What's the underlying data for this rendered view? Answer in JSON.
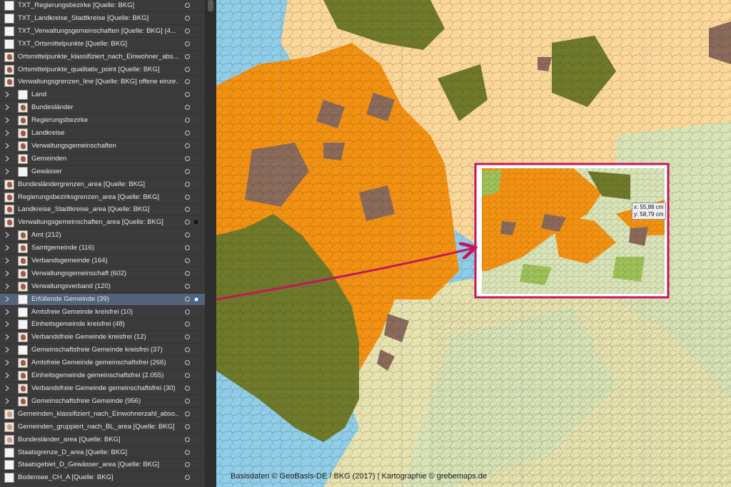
{
  "layers_panel": {
    "rows": [
      {
        "label": "TXT_Regierungsbezirke [Quelle: BKG]",
        "thumb": "blank",
        "indent": 0
      },
      {
        "label": "TXT_Landkreise_Stadtkreise [Quelle: BKG]",
        "thumb": "blank",
        "indent": 0
      },
      {
        "label": "TXT_Verwaltungsgemeinschaften [Quelle: BKG] (4...",
        "thumb": "blank",
        "indent": 0
      },
      {
        "label": "TXT_Ortsmittelpunkte [Quelle: BKG]",
        "thumb": "blank",
        "indent": 0
      },
      {
        "label": "Ortsmittelpunkte_klassifiziert_nach_Einwohner_abs...",
        "thumb": "map",
        "indent": 0
      },
      {
        "label": "Ortsmittelpunkte_qualitativ_point [Quelle: BKG]",
        "thumb": "map",
        "indent": 0
      },
      {
        "label": "Verwaltungsgrenzen_line [Quelle: BKG] offene einze...",
        "thumb": "map",
        "indent": 0
      },
      {
        "label": "Land",
        "thumb": "dots",
        "indent": 1
      },
      {
        "label": "Bundesländer",
        "thumb": "map",
        "indent": 1
      },
      {
        "label": "Regierungsbezirke",
        "thumb": "map",
        "indent": 1
      },
      {
        "label": "Landkreise",
        "thumb": "map",
        "indent": 1
      },
      {
        "label": "Verwaltungsgemeinschaften",
        "thumb": "map",
        "indent": 1
      },
      {
        "label": "Gemeinden",
        "thumb": "map",
        "indent": 1
      },
      {
        "label": "Gewässer",
        "thumb": "dots",
        "indent": 1
      },
      {
        "label": "Bundesländergrenzen_area [Quelle: BKG]",
        "thumb": "map",
        "indent": 0
      },
      {
        "label": "Regierungsbezirksgrenzen_area [Quelle: BKG]",
        "thumb": "map",
        "indent": 0
      },
      {
        "label": "Landkreise_Stadtkreise_area [Quelle: BKG]",
        "thumb": "map",
        "indent": 0
      },
      {
        "label": "Verwaltungsgemeinschaften_area [Quelle: BKG]",
        "thumb": "map",
        "indent": 0,
        "square": true
      },
      {
        "label": "Amt (212)",
        "thumb": "map",
        "indent": 1
      },
      {
        "label": "Samtgemeinde (116)",
        "thumb": "map",
        "indent": 1
      },
      {
        "label": "Verbandsgemeinde (164)",
        "thumb": "map",
        "indent": 1
      },
      {
        "label": "Verwaltungsgemeinschaft (602)",
        "thumb": "map",
        "indent": 1
      },
      {
        "label": "Verwaltungsverband (120)",
        "thumb": "map",
        "indent": 1
      },
      {
        "label": "Erfüllende Gemeinde (39)",
        "thumb": "dots",
        "indent": 1,
        "selected": true
      },
      {
        "label": "Amtsfreie Gemeinde kreisfrei (10)",
        "thumb": "dots",
        "indent": 1
      },
      {
        "label": "Einheitsgemeinde kreisfrei (48)",
        "thumb": "dots",
        "indent": 1
      },
      {
        "label": "Verbandsfreie Gemeinde kreisfrei (12)",
        "thumb": "map",
        "indent": 1
      },
      {
        "label": "Gemeinschaftsfreie Gemeinde kreisfrei (37)",
        "thumb": "dots",
        "indent": 1
      },
      {
        "label": "Amtsfreie Gemeinde gemeinschaftsfrei (266)",
        "thumb": "map",
        "indent": 1
      },
      {
        "label": "Einheitsgemeinde gemeinschaftsfrei (2.055)",
        "thumb": "map",
        "indent": 1
      },
      {
        "label": "Verbandsfreie Gemeinde gemeinschaftsfrei (30)",
        "thumb": "map",
        "indent": 1
      },
      {
        "label": "Gemeinschaftsfreie Gemeinde (956)",
        "thumb": "map",
        "indent": 1
      },
      {
        "label": "Gemeinden_klassifiziert_nach_Einwohnerzahl_abso...",
        "thumb": "pale",
        "indent": 0
      },
      {
        "label": "Gemeinden_gruppiert_nach_BL_area [Quelle: BKG]",
        "thumb": "pale",
        "indent": 0
      },
      {
        "label": "Bundesländer_area [Quelle: BKG]",
        "thumb": "pale",
        "indent": 0
      },
      {
        "label": "Staatsgrenze_D_area [Quelle: BKG]",
        "thumb": "blank",
        "indent": 0
      },
      {
        "label": "Staatsgebiet_D_Gewässer_area [Quelle: BKG]",
        "thumb": "blank",
        "indent": 0
      },
      {
        "label": "Bodensee_CH_A [Quelle: BKG]",
        "thumb": "blank",
        "indent": 0
      }
    ]
  },
  "map": {
    "credit": "Basisdaten © GeoBasis-DE / BKG (2017)  |  Kartographie © grebemaps.de",
    "coordinate_readout": {
      "x": "x: 55,88 cm",
      "y": "y: 58,79 cm"
    },
    "colors": {
      "sea": "#8fcde8",
      "orange": "#f39212",
      "olive": "#6e7a2a",
      "brown": "#8a6a5a",
      "peach": "#fbd79a",
      "pale_green": "#d8e4b8",
      "light_green": "#9ec25a",
      "highlight_frame": "#c2185b"
    }
  }
}
